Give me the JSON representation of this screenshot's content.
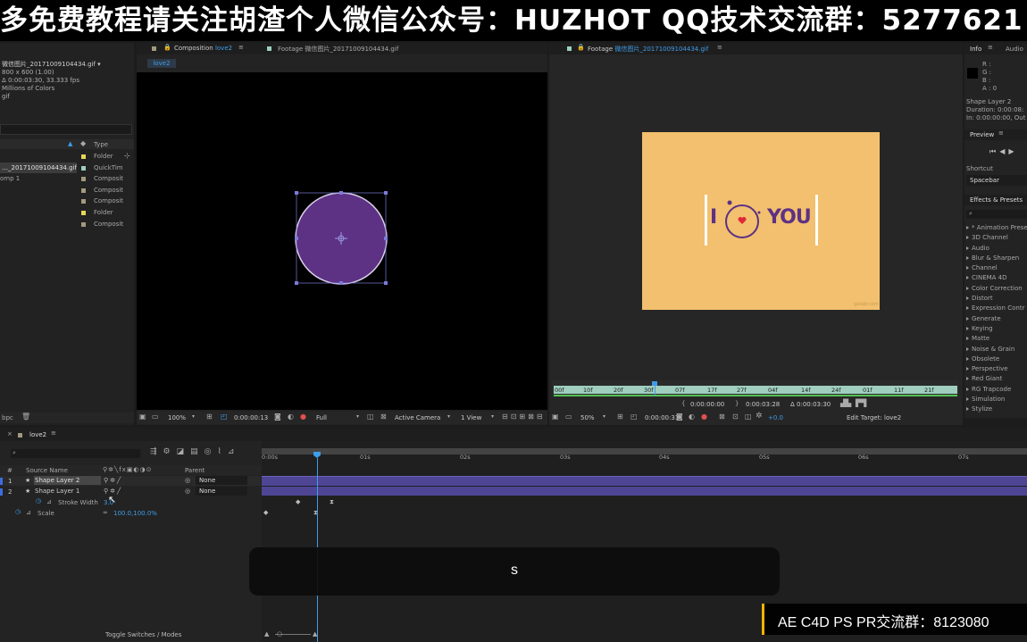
{
  "banner": {
    "text": "多免费教程请关注胡渣个人微信公众号：HUZHOT QQ技术交流群：5277621"
  },
  "project": {
    "file_name": "微信图片_20171009104434.gif ▾",
    "info": [
      "800 x 600 (1.00)",
      "Δ 0:00:03:30, 33.333 fps",
      "Millions of Colors",
      "gif"
    ],
    "type_header": "Type",
    "items": [
      {
        "name": "",
        "type": "Folder",
        "color": "#e6d65a"
      },
      {
        "name": "…_20171009104434.gif",
        "type": "QuickTim",
        "color": "#9ad0c0"
      },
      {
        "name": "omp 1",
        "type": "Composit",
        "color": "#a39a7e"
      },
      {
        "name": "",
        "type": "Composit",
        "color": "#a39a7e"
      },
      {
        "name": "",
        "type": "Composit",
        "color": "#a39a7e"
      },
      {
        "name": "",
        "type": "Folder",
        "color": "#e6d65a"
      },
      {
        "name": "",
        "type": "Composit",
        "color": "#a39a7e"
      }
    ],
    "bpc": "bpc"
  },
  "comp_panel": {
    "tab_comp": "Composition",
    "tab_comp_name": "love2",
    "tab_footage": "Footage 微信图片_20171009104434.gif",
    "sub_tab": "love2",
    "zoom": "100%",
    "time": "0:00:00:13",
    "resolution": "Full",
    "camera": "Active Camera",
    "view": "1 View"
  },
  "footage_panel": {
    "tab": "Footage",
    "tab_name": "微信图片_20171009104434.gif",
    "text_i": "I",
    "text_you": "YOU",
    "watermark": "gaiabr.com",
    "ruler_labels": [
      "00f",
      "10f",
      "20f",
      "30f",
      "07f",
      "17f",
      "27f",
      "04f",
      "14f",
      "24f",
      "01f",
      "11f",
      "21f"
    ],
    "in_time": "0:00:00:00",
    "out_time": "0:00:03:28",
    "duration": "Δ 0:00:03:30",
    "zoom": "50%",
    "time": "0:00:00:31",
    "exposure": "+0.0",
    "edit_target": "Edit Target: love2",
    "playhead_fraction": 0.24,
    "colors": {
      "card": "#f2c06e",
      "purple": "#5d3184",
      "heart": "#e0283a"
    }
  },
  "info_panel": {
    "tab_info": "Info",
    "tab_audio": "Audio",
    "rgba": [
      "R :",
      "G :",
      "B :",
      "A : 0"
    ],
    "layer": "Shape Layer 2",
    "duration": "Duration: 0:00:08:",
    "in_out": "In: 0:00:00:00, Out",
    "preview_label": "Preview",
    "shortcut_label": "Shortcut",
    "shortcut_value": "Spacebar",
    "effects_label": "Effects & Presets",
    "effects": [
      "* Animation Prese",
      "3D Channel",
      "Audio",
      "Blur & Sharpen",
      "Channel",
      "CINEMA 4D",
      "Color Correction",
      "Distort",
      "Expression Contr",
      "Generate",
      "Keying",
      "Matte",
      "Noise & Grain",
      "Obsolete",
      "Perspective",
      "Red Giant",
      "RG Trapcode",
      "Simulation",
      "Stylize"
    ]
  },
  "timeline": {
    "tab": "love2",
    "col_num": "#",
    "col_source": "Source Name",
    "col_parent": "Parent",
    "layers": [
      {
        "num": "1",
        "name": "Shape Layer 2",
        "parent": "None"
      },
      {
        "num": "2",
        "name": "Shape Layer 1",
        "parent": "None"
      }
    ],
    "prop_stroke": "Stroke Width",
    "prop_stroke_value": "3.0",
    "prop_scale": "Scale",
    "prop_scale_value": "100.0,100.0%",
    "ruler": [
      "0:00s",
      "01s",
      "02s",
      "03s",
      "04s",
      "05s",
      "06s",
      "07s"
    ],
    "toggle": "Toggle Switches / Modes"
  },
  "subtitle": "s",
  "footer_banner": "AE C4D PS PR交流群：8123080"
}
